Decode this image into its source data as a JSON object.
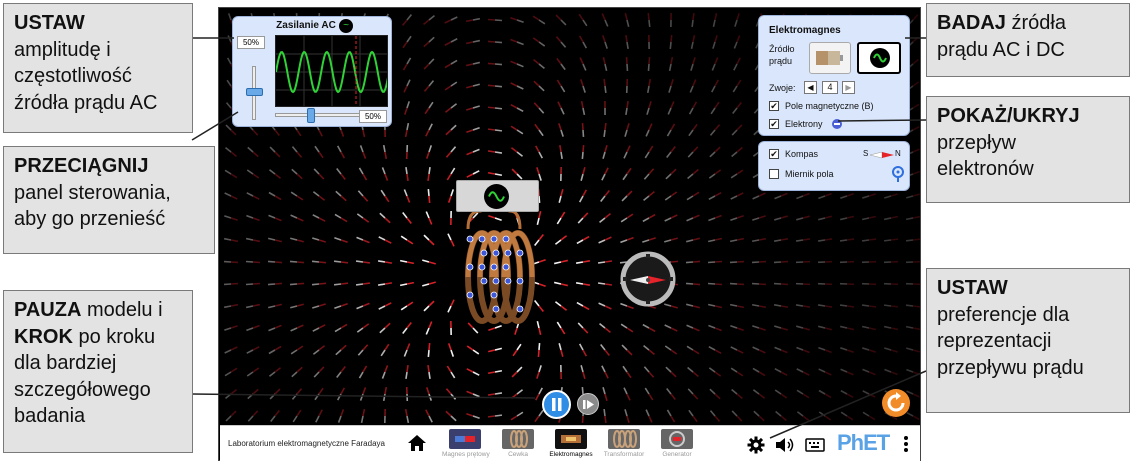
{
  "callouts": {
    "set_ac": {
      "line1_bold": "USTAW",
      "line2": "amplitudę i",
      "line3": "częstotliwość",
      "line4": "źródła prądu AC"
    },
    "drag": {
      "line1_bold": "PRZECIĄGNIJ",
      "line2": "panel sterowania,",
      "line3": "aby go przenieść"
    },
    "pause": {
      "bold1": "PAUZA",
      "rest1": " modelu i",
      "bold2": "KROK",
      "rest2": " po kroku",
      "line3": "dla bardziej",
      "line4": "szczegółowego",
      "line5": "badania"
    },
    "explore": {
      "bold": "BADAJ",
      "rest": " źródła",
      "line2": "prądu AC i DC"
    },
    "show_hide": {
      "line1_bold": "POKAŻ/UKRYJ",
      "line2": "przepływ",
      "line3": "elektronów"
    },
    "preferences": {
      "line1_bold": "USTAW",
      "line2": "preferencje dla",
      "line3": "reprezentacji",
      "line4": "przepływu prądu"
    }
  },
  "ac_panel": {
    "title": "Zasilanie AC",
    "amplitude_label": "50%",
    "frequency_label": "50%",
    "amplitude_fraction": 0.5,
    "frequency_fraction": 0.5
  },
  "em_panel": {
    "title": "Elektromagnes",
    "source_label_1": "Źródło",
    "source_label_2": "prądu",
    "loops_label": "Zwoje:",
    "loops_value": "4",
    "magnetic_field_label": "Pole magnetyczne (B)",
    "magnetic_field_checked": true,
    "electrons_label": "Elektrony",
    "electrons_checked": true
  },
  "compass_panel": {
    "compass_label": "Kompas",
    "compass_checked": true,
    "compass_s": "S",
    "compass_n": "N",
    "field_meter_label": "Miernik pola",
    "field_meter_checked": false
  },
  "navbar": {
    "title": "Laboratorium elektromagnetyczne Faradaya",
    "screens": [
      {
        "label": "Magnes prętowy",
        "active": false
      },
      {
        "label": "Cewka",
        "active": false
      },
      {
        "label": "Elektromagnes",
        "active": true
      },
      {
        "label": "Transformator",
        "active": false
      },
      {
        "label": "Generator",
        "active": false
      }
    ],
    "logo": "PhET"
  },
  "colors": {
    "panel_bg": "#d9e6fb",
    "accent_blue": "#2f8de6",
    "reset_orange": "#f28c28",
    "wave_green": "#2fd335",
    "coil_brown": "#b5703a"
  },
  "icons": [
    "home-icon",
    "gear-icon",
    "sound-icon",
    "keyboard-icon",
    "kebab-menu-icon",
    "pause-icon",
    "step-icon",
    "reset-icon",
    "ac-source-icon",
    "battery-icon",
    "magnifier-probe-icon",
    "minus-icon"
  ]
}
